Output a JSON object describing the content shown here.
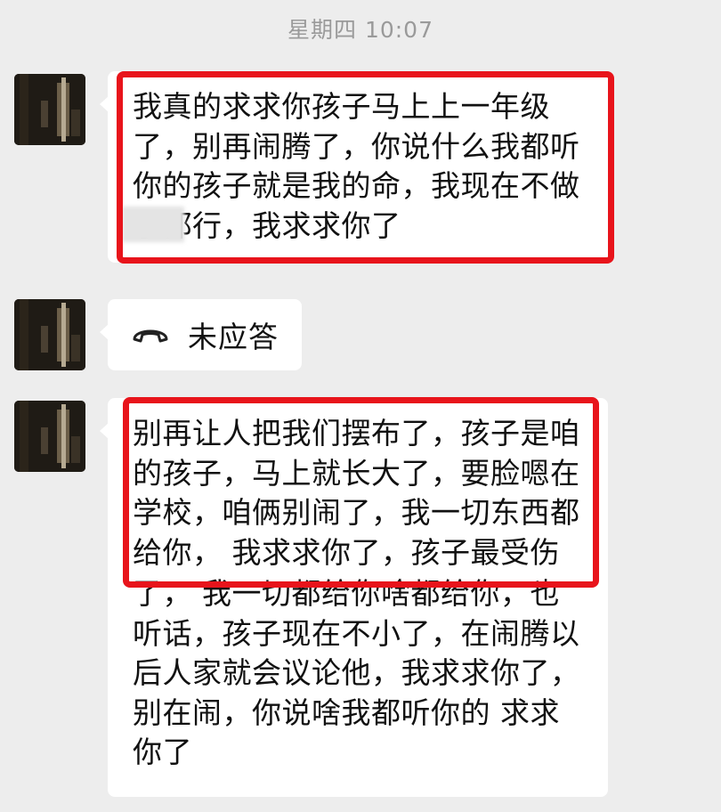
{
  "header": {
    "timestamp": "星期四 10:07"
  },
  "messages": [
    {
      "type": "text",
      "text": "我真的求求你孩子马上上一年级\n了，别再闹腾了，你说什么我都听\n你的孩子就是我的命，我现在不做\n    了都行，我求求你了",
      "highlighted": true,
      "has_blurred_region": true
    },
    {
      "type": "call",
      "icon": "phone-hangup-icon",
      "text": "未应答"
    },
    {
      "type": "text",
      "text_highlighted": "别再让人把我们摆布了，孩子是咱\n的孩子，马上就长大了，要脸嗯在\n学校，咱俩别闹了，我一切东西都\n给你， 我求求你了，孩子最受伤",
      "text_rest": "了， 我一切都给你啥都给你，也\n听话，孩子现在不小了，在闹腾以\n后人家就会议论他，我求求你了，\n别在闹，你说啥我都听你的 求求\n你了",
      "highlighted": true
    }
  ],
  "colors": {
    "background": "#ededed",
    "bubble": "#ffffff",
    "highlight_border": "#e8141b",
    "timestamp": "#9a9a9a"
  }
}
